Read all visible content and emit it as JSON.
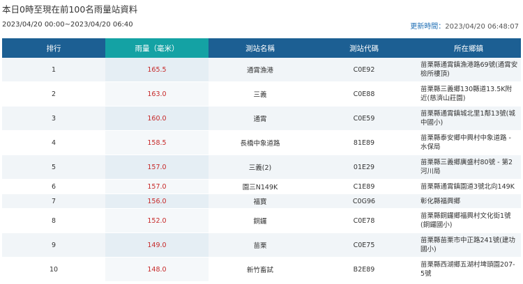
{
  "header": {
    "title": "本日0時至現在前100名雨量站資料",
    "period": "2023/04/20 00:00~2023/04/20 06:40",
    "updated_label": "更新時間：",
    "updated_time": "2023/04/20 06:48:07"
  },
  "table": {
    "columns": [
      "排行",
      "雨量（毫米）",
      "測站名稱",
      "測站代碼",
      "所在鄉鎮"
    ],
    "rows": [
      {
        "rank": "1",
        "rain": "165.5",
        "name": "通霄漁港",
        "code": "C0E92",
        "location": "苗栗縣通霄鎮漁港路69號(通霄安檢所樓頂)"
      },
      {
        "rank": "2",
        "rain": "163.0",
        "name": "三義",
        "code": "C0E88",
        "location": "苗栗縣三義鄉130縣道13.5K附近(慈濟山莊園)"
      },
      {
        "rank": "3",
        "rain": "160.0",
        "name": "通霄",
        "code": "C0E59",
        "location": "苗栗縣通霄鎮城北里1鄰13號(城中國小)"
      },
      {
        "rank": "4",
        "rain": "158.5",
        "name": "長橋中象道路",
        "code": "81E89",
        "location": "苗栗縣泰安鄉中興村中象道路 - 水保局"
      },
      {
        "rank": "5",
        "rain": "157.0",
        "name": "三義(2)",
        "code": "01E29",
        "location": "苗栗縣三義鄉廣盛村80號 - 第2河川局"
      },
      {
        "rank": "6",
        "rain": "157.0",
        "name": "園三N149K",
        "code": "C1E89",
        "location": "苗栗縣通霄鎮園道3號北向149K"
      },
      {
        "rank": "7",
        "rain": "156.0",
        "name": "福寶",
        "code": "C0G96",
        "location": "彰化縣福興鄉"
      },
      {
        "rank": "8",
        "rain": "152.0",
        "name": "銅鑼",
        "code": "C0E78",
        "location": "苗栗縣銅鑼鄉福興村文化街1號(銅鑼國小)"
      },
      {
        "rank": "9",
        "rain": "149.0",
        "name": "苗栗",
        "code": "C0E75",
        "location": "苗栗縣苗栗市中正路241號(建功國小)"
      },
      {
        "rank": "10",
        "rain": "148.0",
        "name": "新竹畜試",
        "code": "B2E89",
        "location": "苗栗縣西湖鄉五湖村埤頭園207-5號"
      }
    ]
  },
  "colors": {
    "header_bg": "#1c5f93",
    "header_highlight_bg": "#14a2a4",
    "rain_value": "#c62828",
    "updated_label": "#1f6fb5"
  }
}
